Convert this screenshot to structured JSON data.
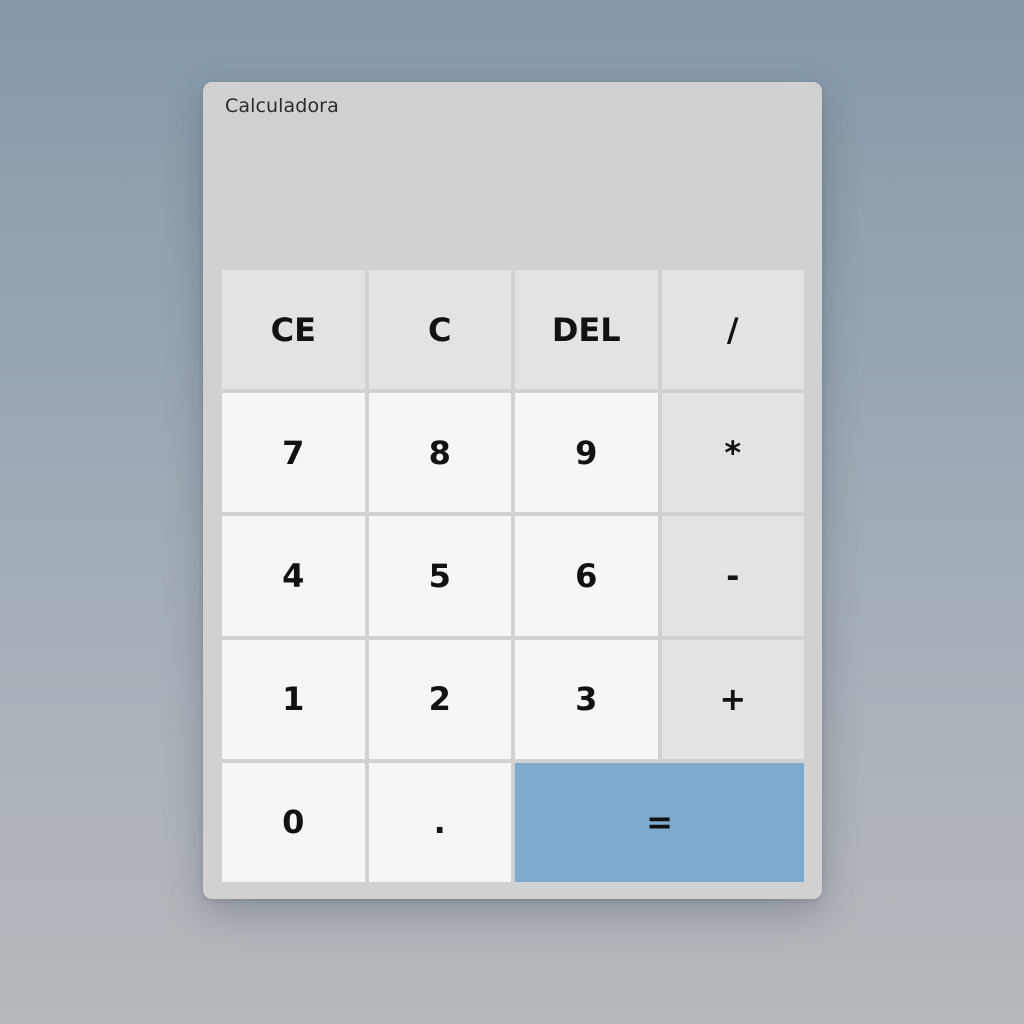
{
  "window": {
    "title": "Calculadora"
  },
  "display": {
    "value": ""
  },
  "keys": [
    {
      "label": "CE",
      "kind": "op"
    },
    {
      "label": "C",
      "kind": "op"
    },
    {
      "label": "DEL",
      "kind": "op"
    },
    {
      "label": "/",
      "kind": "op"
    },
    {
      "label": "7",
      "kind": "num"
    },
    {
      "label": "8",
      "kind": "num"
    },
    {
      "label": "9",
      "kind": "num"
    },
    {
      "label": "*",
      "kind": "op"
    },
    {
      "label": "4",
      "kind": "num"
    },
    {
      "label": "5",
      "kind": "num"
    },
    {
      "label": "6",
      "kind": "num"
    },
    {
      "label": "-",
      "kind": "op"
    },
    {
      "label": "1",
      "kind": "num"
    },
    {
      "label": "2",
      "kind": "num"
    },
    {
      "label": "3",
      "kind": "num"
    },
    {
      "label": "+",
      "kind": "op"
    },
    {
      "label": "0",
      "kind": "num"
    },
    {
      "label": ".",
      "kind": "num"
    },
    {
      "label": "=",
      "kind": "eq"
    }
  ],
  "colors": {
    "number_key": "#f6f6f6",
    "operator_key": "#e3e3e3",
    "equals_key": "#7eaacd",
    "window": "#d1d1d1"
  }
}
